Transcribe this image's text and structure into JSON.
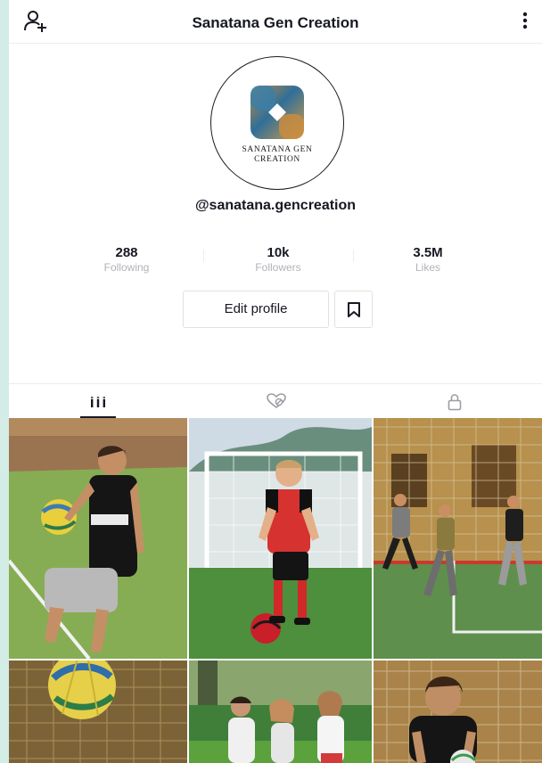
{
  "header": {
    "title": "Sanatana Gen Creation",
    "left_icon": "add-friend-icon",
    "right_icon": "more-vertical-icon"
  },
  "profile": {
    "brand_line_1": "SANATANA GEN",
    "brand_line_2": "CREATION",
    "username": "@sanatana.gencreation",
    "stats": [
      {
        "value": "288",
        "label": "Following"
      },
      {
        "value": "10k",
        "label": "Followers"
      },
      {
        "value": "3.5M",
        "label": "Likes"
      }
    ],
    "edit_label": "Edit profile",
    "bookmark_icon": "bookmark-icon"
  },
  "tabs": [
    {
      "icon": "grid-icon",
      "active": true
    },
    {
      "icon": "liked-heart-icon",
      "active": false
    },
    {
      "icon": "lock-icon",
      "active": false
    }
  ],
  "colors": {
    "text": "#161823",
    "muted": "#b0b2b8",
    "border": "#e1e1e3",
    "page_edge": "#d3ece6"
  }
}
